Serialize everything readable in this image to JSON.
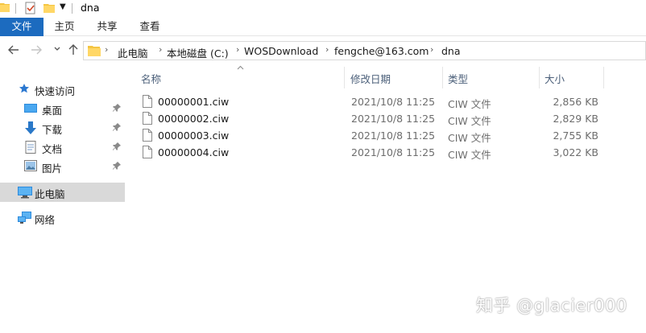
{
  "window": {
    "title": "dna"
  },
  "ribbon": {
    "tabs": [
      "文件",
      "主页",
      "共享",
      "查看"
    ]
  },
  "address": {
    "crumbs": [
      "此电脑",
      "本地磁盘 (C:)",
      "WOSDownload",
      "fengche@163.com",
      "dna"
    ]
  },
  "sidebar": {
    "quick_access": "快速访问",
    "items": [
      "桌面",
      "下载",
      "文档",
      "图片"
    ],
    "this_pc": "此电脑",
    "network": "网络"
  },
  "columns": {
    "name": "名称",
    "date": "修改日期",
    "type": "类型",
    "size": "大小"
  },
  "files": [
    {
      "name": "00000001.ciw",
      "date": "2021/10/8 11:25",
      "type": "CIW 文件",
      "size": "2,856 KB"
    },
    {
      "name": "00000002.ciw",
      "date": "2021/10/8 11:25",
      "type": "CIW 文件",
      "size": "2,829 KB"
    },
    {
      "name": "00000003.ciw",
      "date": "2021/10/8 11:25",
      "type": "CIW 文件",
      "size": "2,755 KB"
    },
    {
      "name": "00000004.ciw",
      "date": "2021/10/8 11:25",
      "type": "CIW 文件",
      "size": "3,022 KB"
    }
  ],
  "watermark": "知乎 @glacier000",
  "colors": {
    "file_tab": "#1c6bbf",
    "selected_nav": "#d9d9d9",
    "header_text": "#4c607a",
    "folder": "#f4c542"
  }
}
